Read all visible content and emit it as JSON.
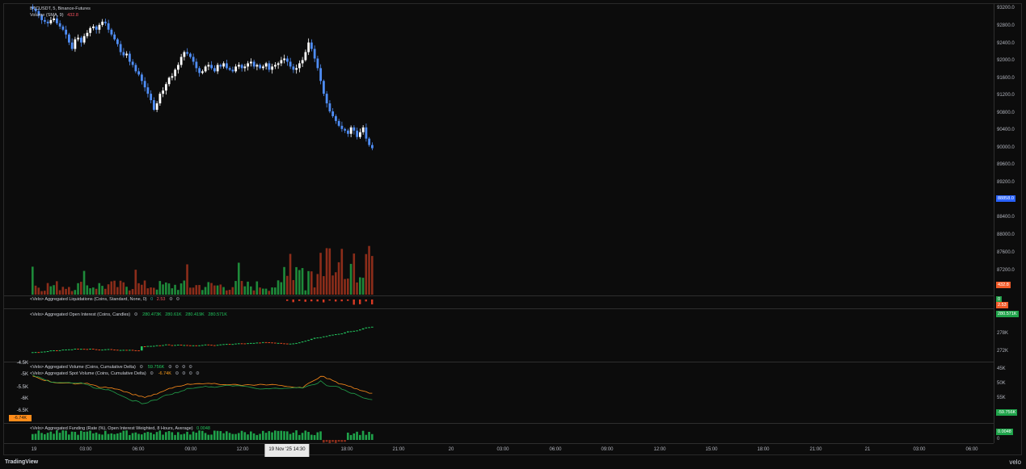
{
  "symbol_legend": {
    "title": "BTCUSDT, 5, Binance-Futures",
    "volume_label": "Volume (SMA, 9)",
    "volume_value": "432.8"
  },
  "panes": {
    "liquidations": {
      "label": "<Velo> Aggregated Liquidations (Coins, Standard, None, 0)",
      "v1": "0",
      "v2": "2.53"
    },
    "open_interest": {
      "label": "<Velo> Aggregated Open Interest (Coins, Candles)",
      "values": [
        "280.473K",
        "280.61K",
        "280.419K",
        "280.571K"
      ]
    },
    "agg_volume": {
      "label": "<Velo> Aggregated Volume (Coins, Cumulative Delta)",
      "value": "59.756K"
    },
    "spot_volume": {
      "label": "<Velo> Aggregated Spot Volume (Coins, Cumulative Delta)",
      "value": "-6.74K"
    },
    "funding": {
      "label": "<Velo> Aggregated Funding (Rate (%), Open Interest Weighted, 8 Hours, Average)",
      "value": "0.0048"
    }
  },
  "price_axis": {
    "labels": [
      "93200.0",
      "92800.0",
      "92400.0",
      "92000.0",
      "91600.0",
      "91200.0",
      "90800.0",
      "90400.0",
      "90000.0",
      "89600.0",
      "89200.0",
      "88400.0",
      "88000.0",
      "87600.0",
      "87200.0"
    ],
    "current_price": "88858.0",
    "volume_badge": "432.8",
    "liq_badge_top": "0",
    "liq_badge_bottom": "2.53",
    "oi_badge": "280.571K",
    "oi_labels": [
      "278K",
      "272K"
    ],
    "vol_labels": [
      "45K",
      "50K",
      "55K"
    ],
    "vol_badge": "-59.756K",
    "funding_badge": "0.0048",
    "funding_zero": "0"
  },
  "left_axis": {
    "labels": [
      "-4.5K",
      "-5K",
      "-5.5K",
      "-6K",
      "-6.5K"
    ],
    "badge": "-6.74K"
  },
  "time_axis": {
    "ticks": [
      "19",
      "03:00",
      "06:00",
      "09:00",
      "12:00",
      "18:00",
      "21:00",
      "20",
      "03:00",
      "06:00",
      "09:00",
      "12:00",
      "15:00",
      "18:00",
      "21:00",
      "21",
      "03:00",
      "06:00"
    ],
    "active": "19 Nov '25   14:30"
  },
  "chart_data": {
    "type": "candlestick",
    "price_ylim": [
      87000,
      93300
    ],
    "closes": [
      93250,
      93180,
      93050,
      92900,
      92850,
      92800,
      92900,
      92950,
      92800,
      92700,
      92600,
      92450,
      92200,
      92000,
      92300,
      92350,
      92200,
      92400,
      92500,
      92650,
      92700,
      92600,
      92750,
      92850,
      92800,
      92600,
      92450,
      92300,
      92150,
      91900,
      91800,
      91850,
      91600,
      91500,
      91300,
      91200,
      91000,
      90800,
      90600,
      90400,
      90100,
      90300,
      90600,
      90700,
      90900,
      91100,
      91150,
      91350,
      91500,
      91750,
      91900,
      91850,
      91750,
      91600,
      91400,
      91250,
      91300,
      91450,
      91500,
      91400,
      91300,
      91500,
      91450,
      91550,
      91400,
      91350,
      91300,
      91450,
      91500,
      91400,
      91450,
      91550,
      91600,
      91450,
      91500,
      91400,
      91450,
      91550,
      91350,
      91450,
      91500,
      91550,
      91650,
      91700,
      91600,
      91450,
      91350,
      91400,
      91550,
      91650,
      91900,
      92200,
      92000,
      91700,
      91400,
      91000,
      90600,
      90300,
      90050,
      89900,
      89750,
      89600,
      89500,
      89450,
      89350,
      89550,
      89450,
      89250,
      89400,
      89550,
      89200,
      89000,
      88900
    ]
  }
}
